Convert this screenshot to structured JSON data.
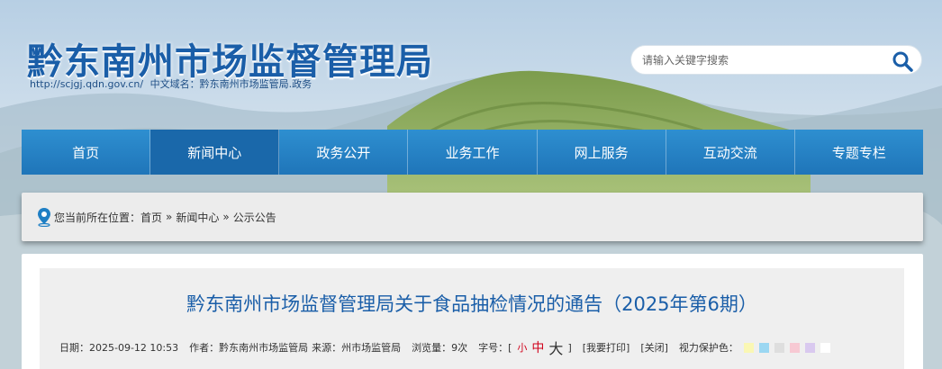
{
  "header": {
    "site_title": "黔东南州市场监督管理局",
    "site_url": "http://scjgj.qdn.gov.cn/",
    "domain_label": "中文域名：黔东南州市场监管局.政务",
    "search_placeholder": "请输入关键字搜索"
  },
  "nav": {
    "items": [
      {
        "label": "首页"
      },
      {
        "label": "新闻中心"
      },
      {
        "label": "政务公开"
      },
      {
        "label": "业务工作"
      },
      {
        "label": "网上服务"
      },
      {
        "label": "互动交流"
      },
      {
        "label": "专题专栏"
      }
    ],
    "active_index": 1
  },
  "breadcrumb": {
    "prefix": "您当前所在位置：",
    "items": [
      "首页",
      "新闻中心",
      "公示公告"
    ],
    "separator": "»"
  },
  "article": {
    "title": "黔东南州市场监督管理局关于食品抽检情况的通告（2025年第6期）",
    "date": "日期：2025-09-12 10:53",
    "author": "作者：黔东南州市场监管局",
    "source": "来源：州市场监管局",
    "views": "浏览量：9次",
    "font_label": "字号：[",
    "font_small": "小",
    "font_mid": "中",
    "font_big": "大",
    "font_close": "]",
    "print_label": "[我要打印]",
    "close_label": "[关闭]",
    "eye_label": "视力保护色："
  },
  "colors": {
    "accent": "#1a5ea8",
    "nav": "#2381c4",
    "swatches": [
      "#faf7b4",
      "#9bd7f2",
      "#dedede",
      "#f7c9d3",
      "#d9c9ef",
      "#ffffff"
    ]
  }
}
